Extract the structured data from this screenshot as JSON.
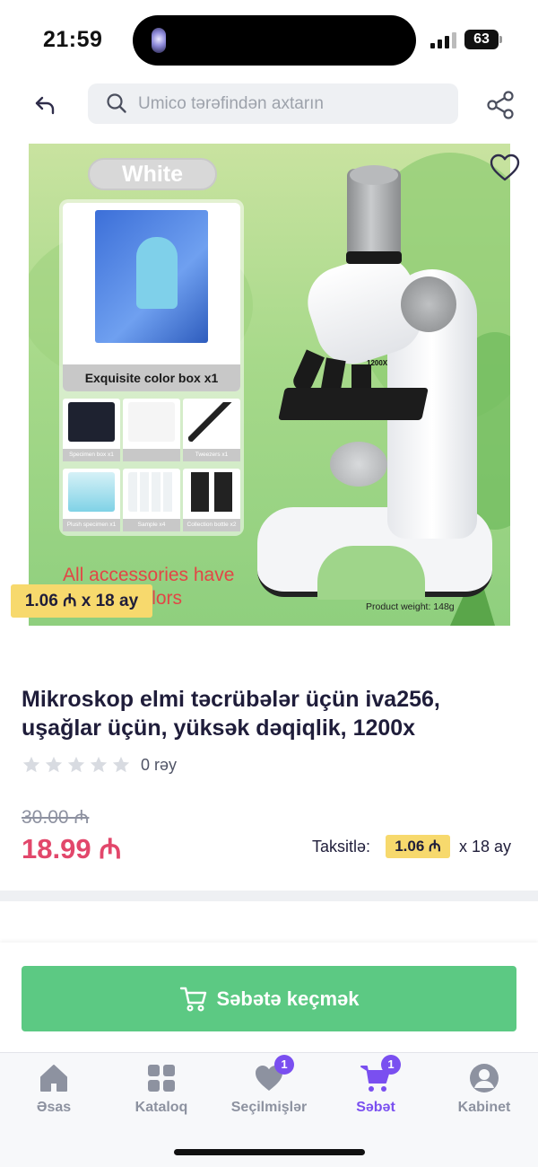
{
  "status_bar": {
    "time": "21:59",
    "battery": "63"
  },
  "nav": {
    "search_placeholder": "Umico tərəfindən axtarın"
  },
  "product_image": {
    "color_badge": "White",
    "box_caption": "Exquisite color box x1",
    "accessories": [
      {
        "label": "Specimen box x1"
      },
      {
        "label": ""
      },
      {
        "label": "Tweezers x1"
      },
      {
        "label": "Plush specimen x1"
      },
      {
        "label": "Sample x4"
      },
      {
        "label": "Collection bottle x2"
      }
    ],
    "accessory_note": "All accessories have random colors",
    "weight": "Product weight: 148g",
    "scope_label": "1200X",
    "installment_tag": "1.06 ₼ x 18 ay"
  },
  "product": {
    "title": "Mikroskop elmi təcrübələr üçün iva256, uşağlar üçün, yüksək dəqiqlik, 1200x",
    "rating_stars": 0,
    "review_count": "0 rəy",
    "old_price": "30.00 ₼",
    "price": "18.99 ₼",
    "installment_label": "Taksitlə:",
    "installment_amount": "1.06 ₼",
    "installment_term": "x 18 ay"
  },
  "cta": {
    "label": "Səbətə keçmək"
  },
  "tabs": [
    {
      "label": "Əsas",
      "icon": "home-icon",
      "badge": ""
    },
    {
      "label": "Kataloq",
      "icon": "catalog-grid-icon",
      "badge": ""
    },
    {
      "label": "Seçilmişlər",
      "icon": "heart-icon",
      "badge": "1"
    },
    {
      "label": "Səbət",
      "icon": "cart-icon",
      "badge": "1"
    },
    {
      "label": "Kabinet",
      "icon": "user-icon",
      "badge": ""
    }
  ],
  "colors": {
    "accent": "#7a4ff0",
    "cta": "#5cc983",
    "price": "#e2476b",
    "installment": "#f7d96d"
  }
}
